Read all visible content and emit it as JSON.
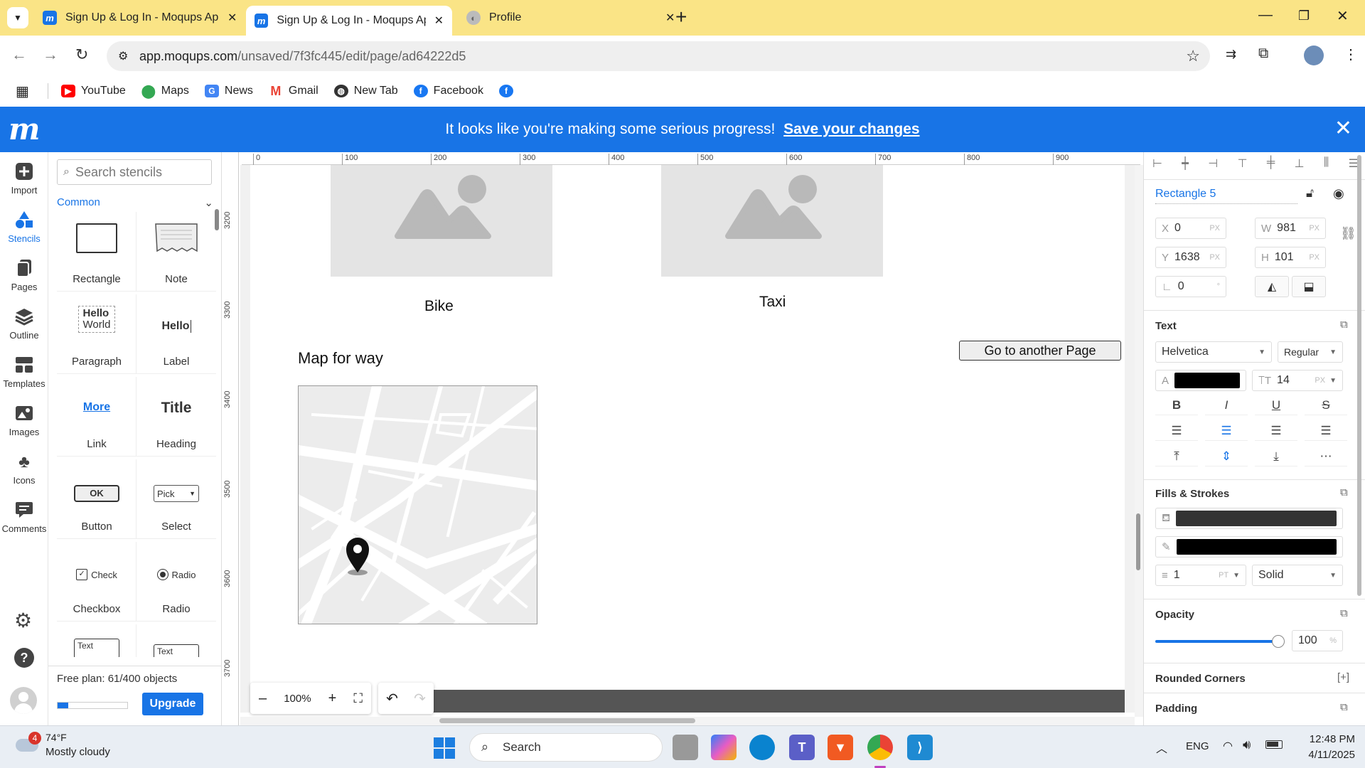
{
  "browser": {
    "tabs": [
      {
        "title": "Sign Up & Log In - Moqups Ap",
        "icon": "moqups-favicon"
      },
      {
        "title": "Sign Up & Log In - Moqups Ap",
        "icon": "moqups-favicon"
      },
      {
        "title": "Profile",
        "icon": "globe-favicon"
      }
    ],
    "new_tab": "+",
    "url_host": "app.moqups.com",
    "url_path": "/unsaved/7f3fc445/edit/page/ad64222d5",
    "bookmarks": [
      {
        "label": "YouTube",
        "icon": "youtube-icon",
        "color": "#ff0000"
      },
      {
        "label": "Maps",
        "icon": "maps-icon",
        "color": "#34a853"
      },
      {
        "label": "News",
        "icon": "news-icon",
        "color": "#4285f4"
      },
      {
        "label": "Gmail",
        "icon": "gmail-icon",
        "color": "#ea4335"
      },
      {
        "label": "New Tab",
        "icon": "globe-icon",
        "color": "#333333"
      },
      {
        "label": "Facebook",
        "icon": "facebook-icon",
        "color": "#1877f2"
      }
    ]
  },
  "moqups": {
    "logo": "m",
    "banner_text": "It looks like you're making some serious progress!",
    "banner_link": "Save your changes",
    "rail": [
      {
        "label": "Import",
        "icon": "plus-square-icon"
      },
      {
        "label": "Stencils",
        "icon": "stencils-icon"
      },
      {
        "label": "Pages",
        "icon": "pages-icon"
      },
      {
        "label": "Outline",
        "icon": "layers-icon"
      },
      {
        "label": "Templates",
        "icon": "templates-icon"
      },
      {
        "label": "Images",
        "icon": "image-icon"
      },
      {
        "label": "Icons",
        "icon": "club-icon"
      },
      {
        "label": "Comments",
        "icon": "comment-icon"
      }
    ],
    "stencils": {
      "search_placeholder": "Search stencils",
      "category": "Common",
      "items": [
        {
          "label": "Rectangle"
        },
        {
          "label": "Note"
        },
        {
          "label": "Paragraph",
          "preview1": "Hello",
          "preview2": "World"
        },
        {
          "label": "Label",
          "preview1": "Hello"
        },
        {
          "label": "Link",
          "preview1": "More"
        },
        {
          "label": "Heading",
          "preview1": "Title"
        },
        {
          "label": "Button",
          "preview1": "OK"
        },
        {
          "label": "Select",
          "preview1": "Pick"
        },
        {
          "label": "Checkbox",
          "preview1": "Check"
        },
        {
          "label": "Radio",
          "preview1": "Radio"
        },
        {
          "label": "",
          "preview1": "Text"
        },
        {
          "label": "",
          "preview1": "Text"
        }
      ],
      "plan_text": "Free plan: 61/400 objects",
      "plan_progress": 0.1525,
      "upgrade": "Upgrade"
    },
    "ruler_top": [
      "0",
      "100",
      "200",
      "300",
      "400",
      "500",
      "600",
      "700",
      "800",
      "900"
    ],
    "ruler_left": [
      "3200",
      "3300",
      "3400",
      "3500",
      "3600",
      "3700"
    ],
    "canvas": {
      "caption_bike": "Bike",
      "caption_taxi": "Taxi",
      "map_heading": "Map for way",
      "goto_button": "Go to another Page"
    },
    "zoom": {
      "minus": "–",
      "value": "100%",
      "plus": "+"
    },
    "props": {
      "name": "Rectangle 5",
      "x": "0",
      "y": "1638",
      "w": "981",
      "h": "101",
      "angle": "0",
      "x_label": "X",
      "y_label": "Y",
      "w_label": "W",
      "h_label": "H",
      "px": "PX",
      "deg": "°",
      "text_title": "Text",
      "font": "Helvetica",
      "weight": "Regular",
      "font_size": "14",
      "text_color": "#000000",
      "fills_title": "Fills & Strokes",
      "fill_color": "#333333",
      "stroke_color": "#000000",
      "stroke_width": "1",
      "stroke_unit": "PT",
      "stroke_style": "Solid",
      "opacity_title": "Opacity",
      "opacity": "100",
      "opacity_unit": "%",
      "rounded_title": "Rounded Corners",
      "padding_title": "Padding"
    }
  },
  "taskbar": {
    "weather_temp": "74°F",
    "weather_desc": "Mostly cloudy",
    "weather_badge": "4",
    "search": "Search",
    "lang": "ENG",
    "time": "12:48 PM",
    "date": "4/11/2025"
  }
}
